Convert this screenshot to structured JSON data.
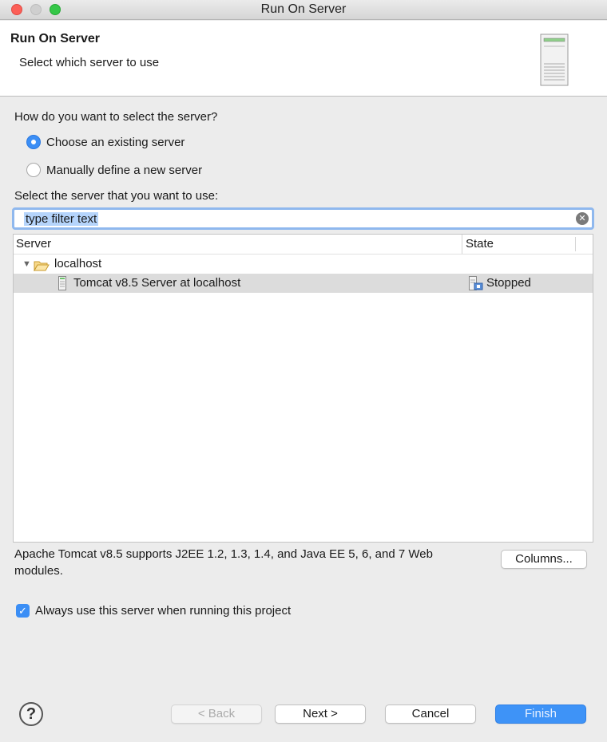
{
  "window": {
    "title": "Run On Server"
  },
  "header": {
    "title": "Run On Server",
    "subtitle": "Select which server to use"
  },
  "selection": {
    "question": "How do you want to select the server?",
    "options": [
      {
        "label": "Choose an existing server",
        "selected": true
      },
      {
        "label": "Manually define a new server",
        "selected": false
      }
    ]
  },
  "server_list": {
    "label": "Select the server that you want to use:",
    "filter_placeholder": "type filter text",
    "columns": [
      "Server",
      "State"
    ],
    "tree": {
      "folder": "localhost",
      "children": [
        {
          "name": "Tomcat v8.5 Server at localhost",
          "state": "Stopped"
        }
      ]
    }
  },
  "description": "Apache Tomcat v8.5 supports J2EE 1.2, 1.3, 1.4, and Java EE 5, 6, and 7 Web modules.",
  "buttons": {
    "columns": "Columns...",
    "back": "< Back",
    "next": "Next >",
    "cancel": "Cancel",
    "finish": "Finish"
  },
  "always_use": {
    "label": "Always use this server when running this project",
    "checked": true
  },
  "colors": {
    "accent": "#3b8ef5",
    "selection_row": "#dcdcdc"
  }
}
